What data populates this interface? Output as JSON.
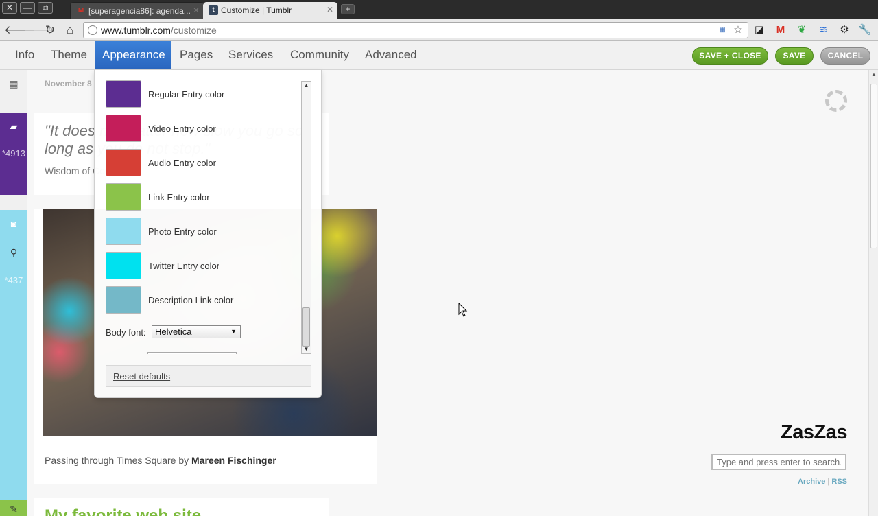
{
  "browser": {
    "window_buttons": [
      "✕",
      "—",
      "⧉"
    ],
    "tabs": [
      {
        "title": "[superagencia86]: agenda...",
        "favicon": "M",
        "favicon_color": "#d93025",
        "active": false
      },
      {
        "title": "Customize | Tumblr",
        "favicon": "t",
        "favicon_color": "#35465c",
        "active": true
      }
    ],
    "new_tab": "+",
    "url_host": "www.tumblr.com",
    "url_path": "/customize"
  },
  "customize_nav": {
    "tabs": [
      "Info",
      "Theme",
      "Appearance",
      "Pages",
      "Services",
      "Community",
      "Advanced"
    ],
    "active_tab": "Appearance",
    "save_close_label": "SAVE + CLOSE",
    "save_label": "SAVE",
    "cancel_label": "CANCEL"
  },
  "appearance_panel": {
    "colors": [
      {
        "label": "Regular Entry color",
        "value": "#5c2d91"
      },
      {
        "label": "Video Entry color",
        "value": "#c41e5a"
      },
      {
        "label": "Audio Entry color",
        "value": "#d63f35"
      },
      {
        "label": "Link Entry color",
        "value": "#8bc34a"
      },
      {
        "label": "Photo Entry color",
        "value": "#8fdbee"
      },
      {
        "label": "Twitter Entry color",
        "value": "#00e1ef"
      },
      {
        "label": "Description Link color",
        "value": "#74b8c8"
      }
    ],
    "body_font_label": "Body font:",
    "body_font_value": "Helvetica",
    "reset_label": "Reset defaults"
  },
  "preview": {
    "date": "November 8",
    "quote_text": "\"It does not matter how slow you go so long as you do not stop.\"",
    "quote_source": "Wisdom of Confucius",
    "sidebar_counts": [
      "*4913",
      "*437"
    ],
    "photo_caption_prefix": "Passing through Times Square by ",
    "photo_caption_author": "Mareen Fischinger",
    "link_post_title": "My favorite web site",
    "blog_title": "ZasZas",
    "search_placeholder": "Type and press enter to search.",
    "archive_label": "Archive",
    "link_separator": "|",
    "rss_label": "RSS"
  }
}
